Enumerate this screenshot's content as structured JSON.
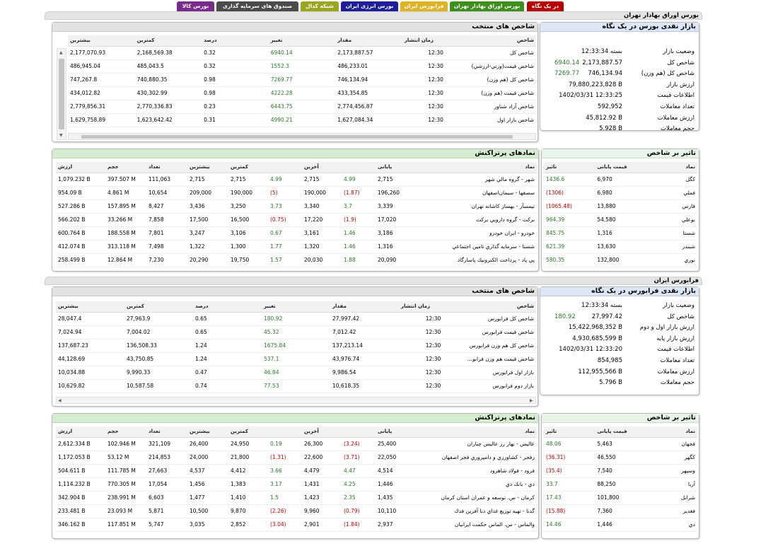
{
  "tabs": [
    {
      "label": "در یک نگاه",
      "color": "#b80000"
    },
    {
      "label": "بورس اوراق بهادار تهران",
      "color": "#3c8f1a"
    },
    {
      "label": "فرابورس ایران",
      "color": "#e0b325"
    },
    {
      "label": "بورس انرژی ایران",
      "color": "#1e1e9b"
    },
    {
      "label": "شبکه کدال",
      "color": "#9aa620"
    },
    {
      "label": "صندوق های سرمایه گذاری",
      "color": "#4b4b4b"
    },
    {
      "label": "بورس کالا",
      "color": "#7a2a8c"
    }
  ],
  "tse": {
    "section_title": "بورس اوراق بهادار تهران",
    "glance": {
      "title": "بازار نقدی بورس در یک نگاه",
      "rows": [
        {
          "label": "وضعیت بازار",
          "value": "بسته 12:33:34",
          "change": ""
        },
        {
          "label": "شاخص کل",
          "value": "2,173,887.57",
          "change": "6940.14"
        },
        {
          "label": "شاخص کل (هم وزن)",
          "value": "746,134.94",
          "change": "7269.77"
        },
        {
          "label": "ارزش بازار",
          "value": "79,880,223,828 B",
          "change": ""
        },
        {
          "label": "اطلاعات قیمت",
          "value": "1402/03/31 12:33:25",
          "change": ""
        },
        {
          "label": "تعداد معاملات",
          "value": "592,952",
          "change": ""
        },
        {
          "label": "ارزش معاملات",
          "value": "45,812.92 B",
          "change": ""
        },
        {
          "label": "حجم معاملات",
          "value": "5.928 B",
          "change": ""
        }
      ]
    },
    "indices": {
      "title": "شاخص های منتخب",
      "headers": [
        "شاخص",
        "زمان انتشار",
        "مقدار",
        "تغییر",
        "درصد",
        "کمترین",
        "بیشترین"
      ],
      "rows": [
        [
          "شاخص کل",
          "12:30",
          "2,173,887.57",
          "6940.14",
          "0.32",
          "2,168,569.38",
          "2,177,070.93"
        ],
        [
          "شاخص قیمت(وزني-ارزشي)",
          "12:30",
          "486,233.01",
          "1552.3",
          "0.32",
          "485,043.5",
          "486,945.04"
        ],
        [
          "شاخص كل (هم وزن)",
          "12:30",
          "746,134.94",
          "7269.77",
          "0.98",
          "740,880.35",
          "747,267.8"
        ],
        [
          "شاخص قيمت (هم وزن)",
          "12:30",
          "433,354.85",
          "4222.28",
          "0.98",
          "430,302.99",
          "434,012.82"
        ],
        [
          "شاخص آزاد شناور",
          "12:30",
          "2,774,456.87",
          "6443.75",
          "0.23",
          "2,770,336.83",
          "2,779,856.31"
        ],
        [
          "شاخص بازار اول",
          "12:30",
          "1,627,084.34",
          "4990.21",
          "0.31",
          "1,623,642.42",
          "1,629,758.89"
        ]
      ]
    },
    "impact": {
      "title": "تاثیر بر شاخص",
      "headers": [
        "نماد",
        "قیمت پایانی",
        "تاثیر"
      ],
      "rows": [
        [
          "کگل",
          "6,970",
          "1436.6",
          "g"
        ],
        [
          "فملي",
          "6,980",
          "(1306)",
          "red"
        ],
        [
          "فارس",
          "13,880",
          "(1065.48)",
          "red"
        ],
        [
          "بوعلي",
          "54,580",
          "964.39",
          "g"
        ],
        [
          "شستا",
          "1,316",
          "845.75",
          "g"
        ],
        [
          "شبندر",
          "13,630",
          "621.39",
          "g"
        ],
        [
          "نوري",
          "132,800",
          "580.35",
          "g"
        ]
      ]
    },
    "active": {
      "title": "نمادهای پرتراکنش",
      "headers": [
        "نماد",
        "پایانی",
        "",
        "آخرین",
        "",
        "کمترین",
        "بیشترین",
        "تعداد",
        "حجم",
        "ارزش"
      ],
      "rows": [
        [
          "شهر - گروه مالي شهر",
          "2,715",
          "4.99",
          "2,715",
          "4.99",
          "2,715",
          "2,715",
          "111,063",
          "397.507 M",
          "1,079.232 B",
          "g",
          "g"
        ],
        [
          "سصفها - سيمان‌اصفهان",
          "196,260",
          "(1.87)",
          "190,000",
          "(5)",
          "190,000",
          "209,000",
          "10,654",
          "4.861 M",
          "954.09 B",
          "red",
          "red"
        ],
        [
          "تيمسآز - بهساز كاشانه تهران",
          "3,339",
          "3.7",
          "3,340",
          "3.73",
          "3,250",
          "3,436",
          "8,427",
          "157.895 M",
          "527.286 B",
          "g",
          "g"
        ],
        [
          "بركت - گروه دارويي بركت",
          "17,020",
          "(1.9)",
          "17,220",
          "(0.75)",
          "16,500",
          "17,500",
          "7,858",
          "33.266 M",
          "566.202 B",
          "red",
          "red"
        ],
        [
          "خودرو - ايران‌ خودرو",
          "3,186",
          "1.46",
          "3,161",
          "0.67",
          "3,106",
          "3,247",
          "7,801",
          "188.558 M",
          "600.764 B",
          "g",
          "g"
        ],
        [
          "شستا - سرمايه گذاري تامين اجتماعي",
          "1,316",
          "1.46",
          "1,320",
          "1.77",
          "1,300",
          "1,322",
          "7,498",
          "313.118 M",
          "412.074 B",
          "g",
          "g"
        ],
        [
          "پي پاد - پرداخت الكترونيك پاسارگاد",
          "20,090",
          "1.88",
          "20,030",
          "1.57",
          "19,750",
          "20,290",
          "7,230",
          "12.864 M",
          "258.499 B",
          "g",
          "g"
        ]
      ]
    }
  },
  "ifb": {
    "section_title": "فرابورس ایران",
    "glance": {
      "title": "بازار نقدی فرابورس در یک نگاه",
      "rows": [
        {
          "label": "وضعیت بازار",
          "value": "بسته 12:33:34",
          "change": ""
        },
        {
          "label": "شاخص کل",
          "value": "27,997.42",
          "change": "180.92"
        },
        {
          "label": "ارزش بازار اول و دوم",
          "value": "15,422,968,352 B",
          "change": ""
        },
        {
          "label": "ارزش بازار پایه",
          "value": "4,930,685,599 B",
          "change": ""
        },
        {
          "label": "اطلاعات قیمت",
          "value": "1402/03/31 12:33:20",
          "change": ""
        },
        {
          "label": "تعداد معاملات",
          "value": "854,985",
          "change": ""
        },
        {
          "label": "ارزش معاملات",
          "value": "112,955,566 B",
          "change": ""
        },
        {
          "label": "حجم معاملات",
          "value": "5.796 B",
          "change": ""
        }
      ]
    },
    "indices": {
      "title": "شاخص های منتخب",
      "headers": [
        "شاخص",
        "زمان انتشار",
        "مقدار",
        "تغییر",
        "درصد",
        "کمترین",
        "بیشترین"
      ],
      "rows": [
        [
          "شاخص كل فرابورس",
          "12:30",
          "27,997.42",
          "180.92",
          "0.65",
          "27,963.9",
          "28,047.4"
        ],
        [
          "شاخص قيمت فرابورس",
          "12:30",
          "7,012.42",
          "45.32",
          "0.65",
          "7,004.02",
          "7,024.94"
        ],
        [
          "شاخص كل هم وزن فرابورس",
          "12:30",
          "137,213.14",
          "1675.84",
          "1.24",
          "136,508.33",
          "137,687.23"
        ],
        [
          "شاخص قيمت هم وزن فرابو...",
          "12:30",
          "43,976.74",
          "537.1",
          "1.24",
          "43,750.85",
          "44,128.69"
        ],
        [
          "بازار اول فرابورس",
          "12:30",
          "9,986.54",
          "46.84",
          "0.47",
          "9,990.33",
          "10,034.88"
        ],
        [
          "بازار دوم فرابورس",
          "12:30",
          "10,618.35",
          "77.53",
          "0.74",
          "10,587.58",
          "10,629.82"
        ]
      ]
    },
    "impact": {
      "title": "تاثیر بر شاخص",
      "headers": [
        "نماد",
        "قیمت پایانی",
        "تاثیر"
      ],
      "rows": [
        [
          "فجهان",
          "5,463",
          "48.06",
          "g"
        ],
        [
          "كگهر",
          "46,550",
          "(36.31)",
          "red"
        ],
        [
          "وسپهر",
          "7,540",
          "(35.4)",
          "red"
        ],
        [
          "آريا",
          "88,250",
          "33.7",
          "g"
        ],
        [
          "شرانل",
          "101,800",
          "17.43",
          "g"
        ],
        [
          "فغدير",
          "7,360",
          "(15.88)",
          "red"
        ],
        [
          "دي",
          "1,446",
          "14.46",
          "g"
        ]
      ]
    },
    "active": {
      "title": "نمادهای پرتراکنش",
      "headers": [
        "نماد",
        "پایانی",
        "",
        "آخرین",
        "",
        "کمترین",
        "بیشترین",
        "تعداد",
        "حجم",
        "ارزش"
      ],
      "rows": [
        [
          "عاليس - بهار رز عاليس چناران",
          "25,400",
          "(3.24)",
          "26,300",
          "0.19",
          "24,950",
          "26,400",
          "321,109",
          "102.946 M",
          "2,612.334 B",
          "red",
          "g"
        ],
        [
          "زفجر - كشاورزي و دامپروري فجر اصفهان",
          "22,050",
          "(3.71)",
          "22,600",
          "(1.31)",
          "21,800",
          "24,000",
          "214,853",
          "53.12 M",
          "1,172.053 B",
          "red",
          "red"
        ],
        [
          "فرود - فولاد شاهرود",
          "4,514",
          "4.47",
          "4,479",
          "3.66",
          "4,412",
          "4,537",
          "27,663",
          "111.785 M",
          "504.611 B",
          "g",
          "g"
        ],
        [
          "دي - بانك دي",
          "1,446",
          "4.25",
          "1,431",
          "3.17",
          "1,383",
          "1,456",
          "17,054",
          "770.305 M",
          "1,114.232 B",
          "g",
          "g"
        ],
        [
          "كرمان - س. توسعه و عمران استان كرمان",
          "1,435",
          "2.35",
          "1,423",
          "1.5",
          "1,410",
          "1,477",
          "6,603",
          "238.991 M",
          "342.904 B",
          "g",
          "g"
        ],
        [
          "گدنا - تهيه توزيع غذاي دنا آفرين فدك",
          "10,110",
          "(0.79)",
          "9,960",
          "(2.26)",
          "9,870",
          "10,500",
          "5,871",
          "23.093 M",
          "233.481 B",
          "red",
          "red"
        ],
        [
          "والماس - س. الماس حكمت ايرانيان",
          "2,937",
          "(1.84)",
          "2,901",
          "(3.04)",
          "2,852",
          "3,035",
          "5,747",
          "117.851 M",
          "346.162 B",
          "red",
          "red"
        ]
      ]
    }
  }
}
